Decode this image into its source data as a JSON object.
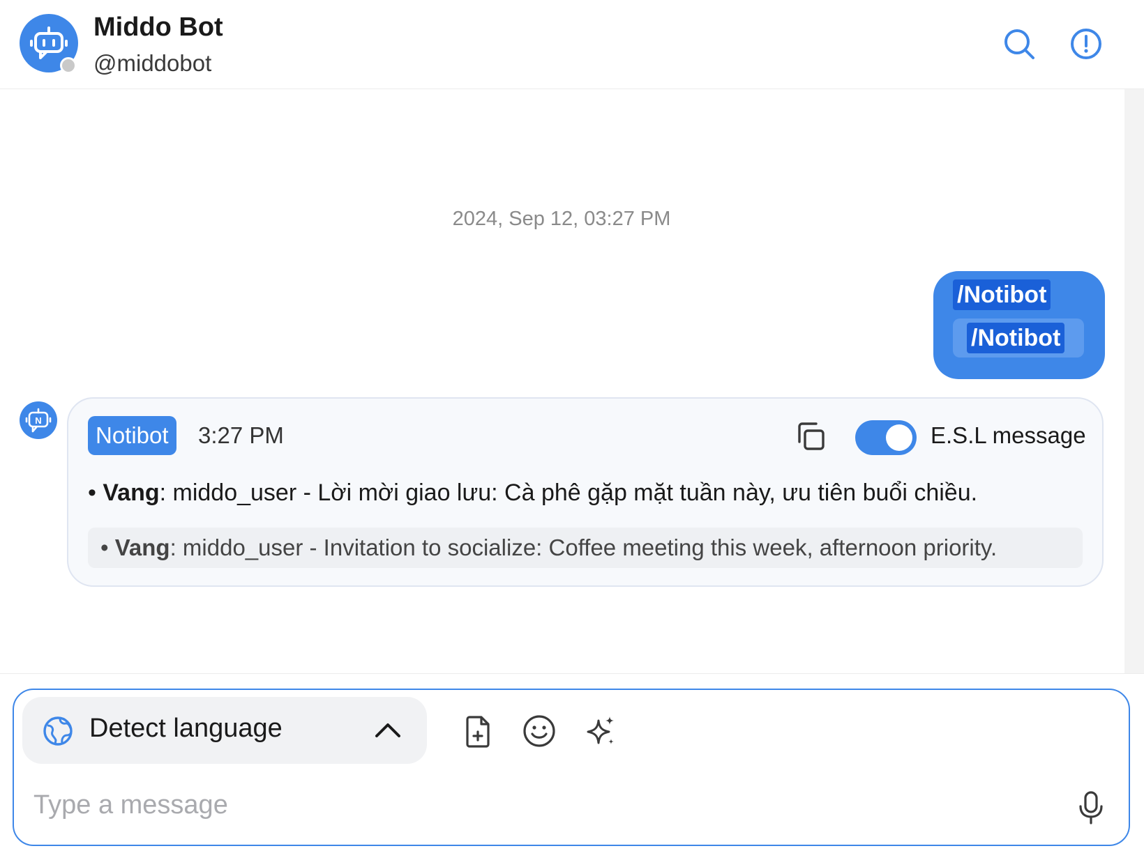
{
  "header": {
    "title": "Middo Bot",
    "handle": "@middobot",
    "icons": [
      "robot-icon",
      "search-icon",
      "info-icon"
    ],
    "status": "offline"
  },
  "conversation": {
    "timestamp": "2024, Sep 12, 03:27 PM",
    "user_message": {
      "command": "/Notibot",
      "command_translation": "/Notibot"
    },
    "bot_message": {
      "sender_tag": "Notibot",
      "time": "3:27 PM",
      "esl_label": "E.S.L message",
      "esl_enabled": true,
      "line_vi_label": "Vang",
      "line_vi_text": ": middo_user - Lời mời giao lưu: Cà phê gặp mặt tuần này, ưu tiên buổi chiều.",
      "line_en_label": "Vang",
      "line_en_text": ": middo_user - Invitation to socialize: Coffee meeting this week, afternoon priority."
    }
  },
  "composer": {
    "language": "Detect language",
    "placeholder": "Type a message",
    "tools": [
      "file-add-icon",
      "emoji-icon",
      "sparkles-icon"
    ]
  },
  "colors": {
    "accent": "#3e87e8",
    "highlight": "#1a60d8",
    "card_bg": "#f7f9fc",
    "card_border": "#dfe5f1"
  }
}
